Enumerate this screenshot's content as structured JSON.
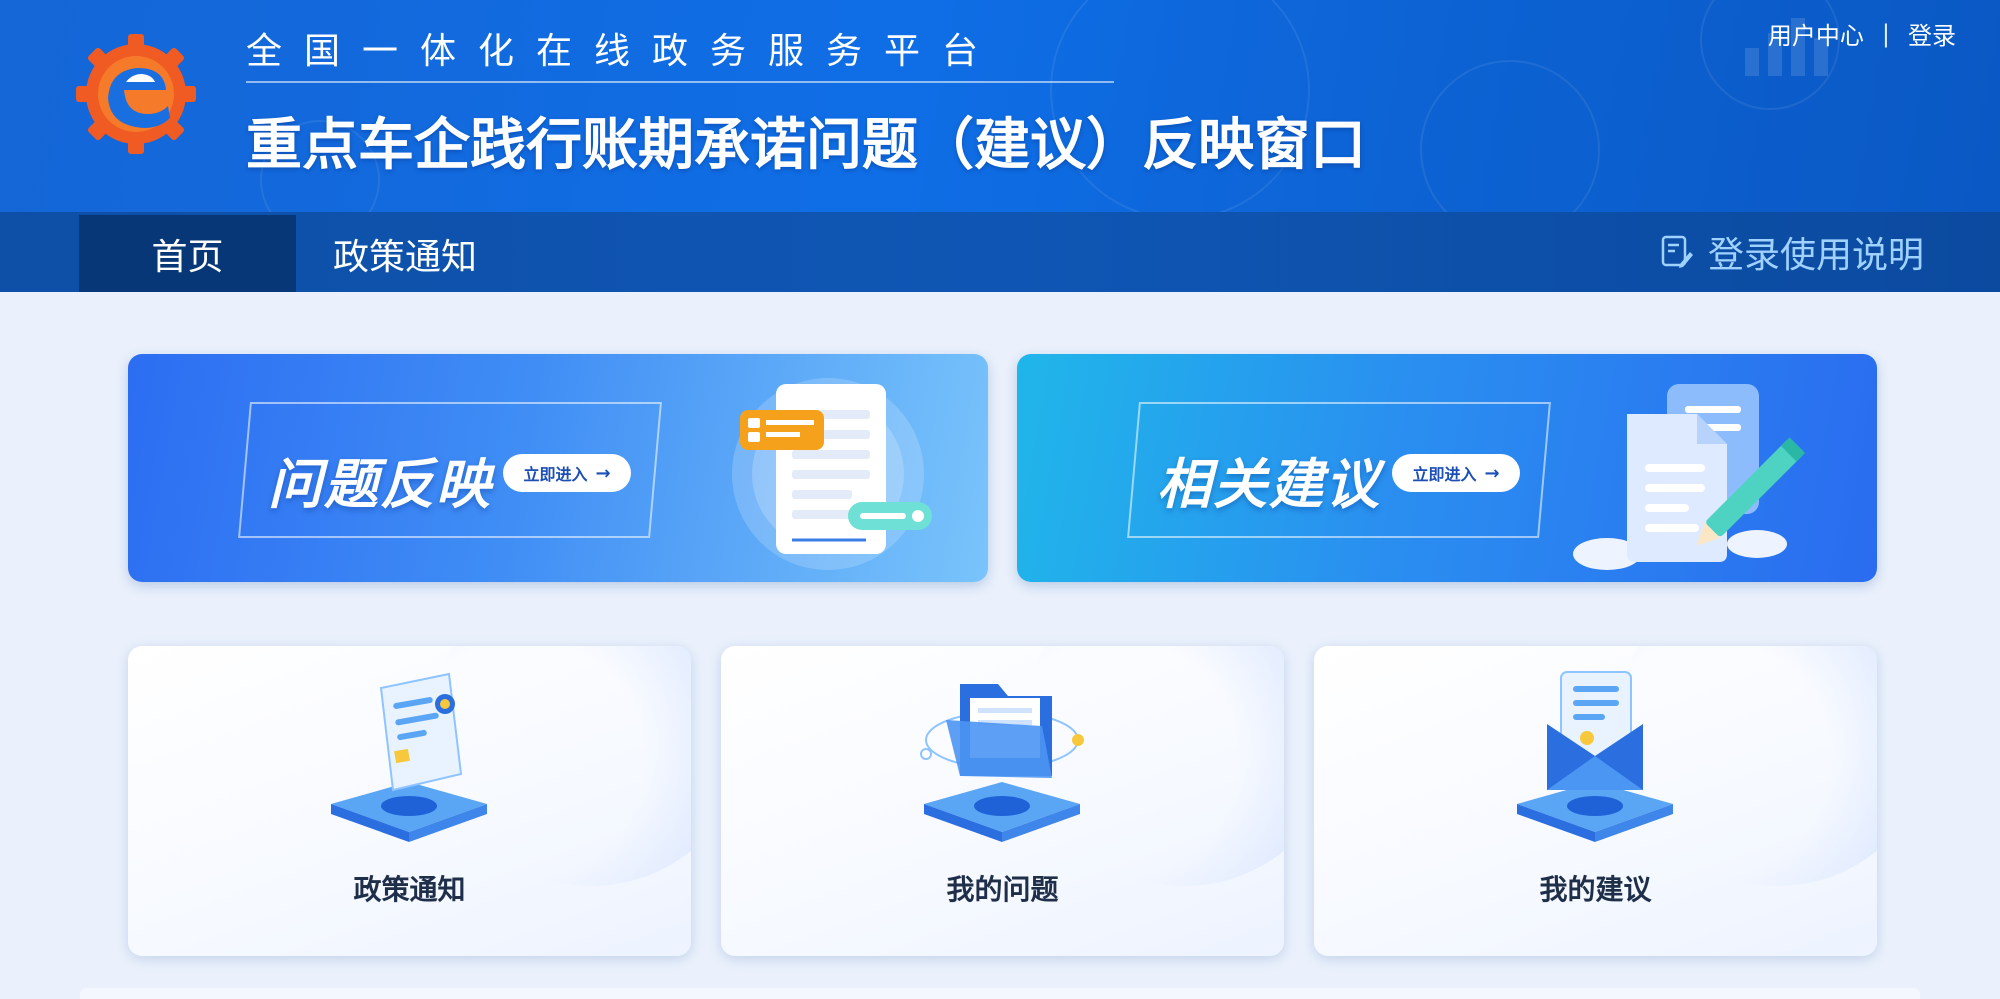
{
  "header": {
    "subtitle": "全国一体化在线政务服务平台",
    "title": "重点车企践行账期承诺问题（建议）反映窗口",
    "user_center": "用户中心",
    "separator": "|",
    "login": "登录"
  },
  "nav": {
    "items": [
      {
        "label": "首页",
        "active": true
      },
      {
        "label": "政策通知",
        "active": false
      }
    ],
    "help": "登录使用说明"
  },
  "banners": [
    {
      "title": "问题反映",
      "button": "立即进入",
      "arrow": "→"
    },
    {
      "title": "相关建议",
      "button": "立即进入",
      "arrow": "→"
    }
  ],
  "cards": [
    {
      "label": "政策通知",
      "icon": "policy-notice-icon"
    },
    {
      "label": "我的问题",
      "icon": "folder-icon"
    },
    {
      "label": "我的建议",
      "icon": "envelope-icon"
    }
  ],
  "colors": {
    "header_blue": "#0f6ee6",
    "nav_blue": "#0f56b4",
    "nav_active": "#073777",
    "help_text": "#9fd2ff",
    "logo_orange": "#f05a23",
    "logo_blue": "#1a6fe0"
  }
}
